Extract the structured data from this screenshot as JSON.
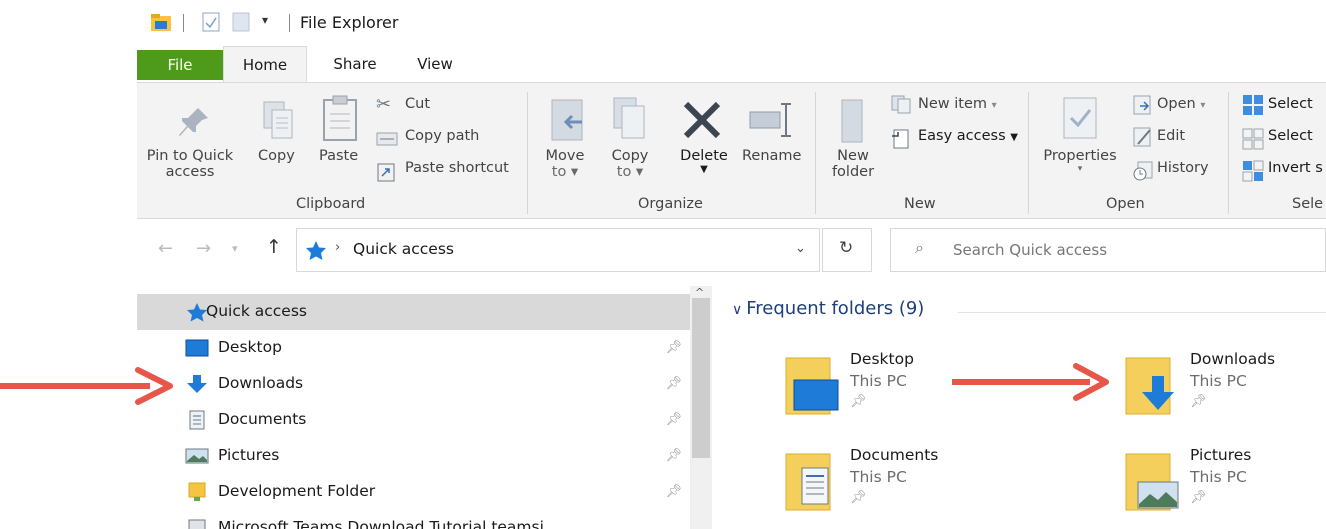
{
  "window": {
    "title": "File Explorer"
  },
  "tabs": [
    {
      "label": "File"
    },
    {
      "label": "Home"
    },
    {
      "label": "Share"
    },
    {
      "label": "View"
    }
  ],
  "ribbon": {
    "clipboard": {
      "label": "Clipboard",
      "pin_label_1": "Pin to Quick",
      "pin_label_2": "access",
      "copy": "Copy",
      "paste": "Paste",
      "cut": "Cut",
      "copy_path": "Copy path",
      "paste_shortcut": "Paste shortcut"
    },
    "organize": {
      "label": "Organize",
      "move_1": "Move",
      "move_2": "to",
      "copy_1": "Copy",
      "copy_2": "to",
      "delete": "Delete",
      "rename": "Rename"
    },
    "new": {
      "label": "New",
      "new_folder_1": "New",
      "new_folder_2": "folder",
      "new_item": "New item",
      "easy_access": "Easy access"
    },
    "open": {
      "label": "Open",
      "properties": "Properties",
      "open": "Open",
      "edit": "Edit",
      "history": "History"
    },
    "select": {
      "label": "Sele",
      "select_all": "Select",
      "select_none": "Select",
      "invert": "Invert s"
    }
  },
  "address": {
    "path": "Quick access",
    "search_placeholder": "Search Quick access"
  },
  "nav": {
    "items": [
      {
        "label": "Quick access"
      },
      {
        "label": "Desktop"
      },
      {
        "label": "Downloads"
      },
      {
        "label": "Documents"
      },
      {
        "label": "Pictures"
      },
      {
        "label": "Development Folder"
      },
      {
        "label": "Microsoft Teams Download Tutorial teamsi"
      }
    ]
  },
  "content": {
    "section_title": "Frequent folders (9)",
    "folders": [
      {
        "name": "Desktop",
        "location": "This PC"
      },
      {
        "name": "Downloads",
        "location": "This PC"
      },
      {
        "name": "Documents",
        "location": "This PC"
      },
      {
        "name": "Pictures",
        "location": "This PC"
      }
    ]
  },
  "colors": {
    "annotation_arrow": "#e8564a",
    "file_tab": "#4e9a1a",
    "accent": "#1e7bd8"
  }
}
